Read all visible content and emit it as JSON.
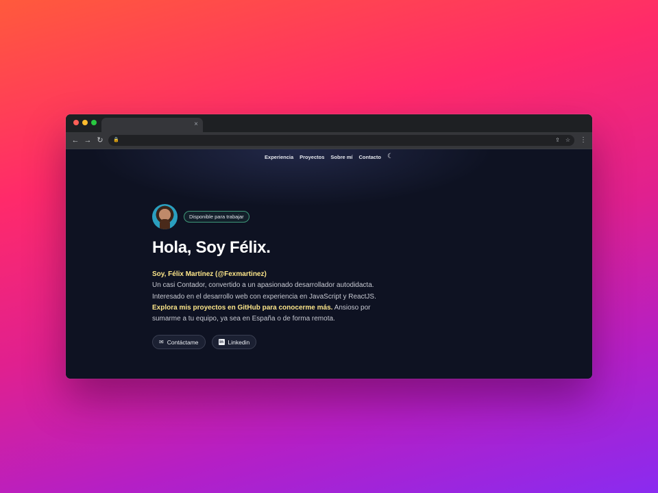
{
  "browser": {
    "tab_close": "×",
    "nav": {
      "back": "←",
      "forward": "→",
      "reload": "↻"
    },
    "lock": "🔒",
    "share": "⇪",
    "star": "☆",
    "menu": "⋮"
  },
  "nav": {
    "items": [
      "Experiencia",
      "Proyectos",
      "Sobre mí",
      "Contacto"
    ],
    "theme_icon": "☾"
  },
  "hero": {
    "badge": "Disponible para trabajar",
    "greeting": "Hola, Soy Félix.",
    "intro_highlight": "Soy, Félix Martínez (@Fexmartinez)",
    "intro_text_1": "Un casi Contador, convertido a un apasionado desarrollador autodidacta. Interesado en el desarrollo web con experiencia en JavaScript y ReactJS.",
    "intro_link": "Explora mis proyectos en GitHub para conocerme más.",
    "intro_text_2": "Ansioso por sumarme a tu equipo, ya sea en España o de forma remota.",
    "contact_button": "Contáctame",
    "contact_icon": "✉",
    "linkedin_button": "Linkedin",
    "linkedin_icon": "in"
  },
  "colors": {
    "accent": "#fde68a",
    "badge_border": "#3f9a7a",
    "page_bg": "#0e1222"
  }
}
